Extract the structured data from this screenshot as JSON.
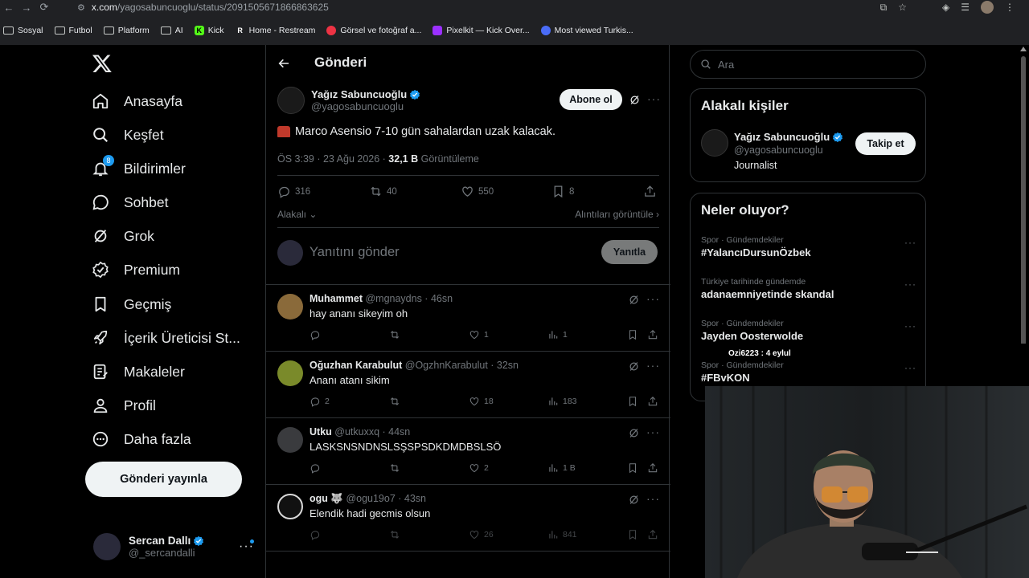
{
  "browser": {
    "url_domain": "x.com",
    "url_path": "/yagosabuncuoglu/status/2091505671866863625",
    "bookmarks": [
      "Sosyal",
      "Futbol",
      "Platform",
      "AI",
      "Kick",
      "Home - Restream",
      "Görsel ve fotoğraf a...",
      "Pixelkit — Kick Over...",
      "Most viewed Turkis..."
    ]
  },
  "nav": {
    "items": [
      {
        "label": "Anasayfa",
        "icon": "home-icon"
      },
      {
        "label": "Keşfet",
        "icon": "search-icon"
      },
      {
        "label": "Bildirimler",
        "icon": "bell-icon",
        "badge": "8"
      },
      {
        "label": "Sohbet",
        "icon": "chat-icon"
      },
      {
        "label": "Grok",
        "icon": "grok-icon"
      },
      {
        "label": "Premium",
        "icon": "verified-icon"
      },
      {
        "label": "Geçmiş",
        "icon": "bookmark-icon"
      },
      {
        "label": "İçerik Üreticisi St...",
        "icon": "rocket-icon"
      },
      {
        "label": "Makaleler",
        "icon": "article-icon"
      },
      {
        "label": "Profil",
        "icon": "person-icon"
      },
      {
        "label": "Daha fazla",
        "icon": "more-circle-icon"
      }
    ],
    "post_button": "Gönderi yayınla",
    "me": {
      "name": "Sercan Dallı",
      "handle": "@_sercandalli"
    }
  },
  "main": {
    "title": "Gönderi",
    "post": {
      "author": "Yağız Sabuncuoğlu",
      "handle": "@yagosabuncuoglu",
      "subscribe": "Abone ol",
      "text": "Marco Asensio 7-10 gün sahalardan uzak kalacak.",
      "meta_time": "ÖS 3:39 · 23 Ağu 2026 · ",
      "views": "32,1 B",
      "views_label": " Görüntüleme",
      "replies": "316",
      "reposts": "40",
      "likes": "550",
      "bookmarks": "8",
      "relevant": "Alakalı",
      "quotes": "Alıntıları görüntüle"
    },
    "reply_placeholder": "Yanıtını gönder",
    "reply_button": "Yanıtla",
    "comments": [
      {
        "name": "Muhammet",
        "handle": "@mgnaydns · 46sn",
        "text": "hay ananı sikeyim oh",
        "replies": "",
        "reposts": "",
        "likes": "1",
        "views": "1",
        "avatar_color": "#8a6a3a"
      },
      {
        "name": "Oğuzhan Karabulut",
        "handle": "@OgzhnKarabulut · 32sn",
        "text": "Ananı atanı sikim",
        "replies": "2",
        "reposts": "",
        "likes": "18",
        "views": "183",
        "avatar_color": "#7a8a2a"
      },
      {
        "name": "Utku",
        "handle": "@utkuxxq · 44sn",
        "text": "LASKSNSNDNSLSŞSPSDKDMDBSLSÖ",
        "replies": "",
        "reposts": "",
        "likes": "2",
        "views": "1 B",
        "avatar_color": "#3a3b3e"
      },
      {
        "name": "ogu 🐺",
        "handle": "@ogu19o7 · 43sn",
        "text": "Elendik hadi gecmis olsun",
        "replies": "",
        "reposts": "",
        "likes": "26",
        "views": "841",
        "avatar_color": "#d8d8d8"
      }
    ]
  },
  "right": {
    "search_placeholder": "Ara",
    "people_title": "Alakalı kişiler",
    "person": {
      "name": "Yağız Sabuncuoğlu",
      "handle": "@yagosabuncuoglu",
      "bio": "Journalist",
      "follow": "Takip et"
    },
    "trends_title": "Neler oluyor?",
    "trends": [
      {
        "cat": "Spor · Gündemdekiler",
        "title": "#YalancıDursunÖzbek"
      },
      {
        "cat": "Türkiye tarihinde gündemde",
        "title": "adanaemniyetinde skandal"
      },
      {
        "cat": "Spor · Gündemdekiler",
        "title": "Jayden Oosterwolde"
      },
      {
        "cat": "Spor · Gündemdekiler",
        "title": "#FBvKON"
      }
    ],
    "overlay_text": "Ozi6223 : 4 eylul"
  },
  "colors": {
    "accent": "#1d9bf0",
    "bg": "#000000",
    "border": "#2f3336",
    "muted": "#71767b"
  }
}
